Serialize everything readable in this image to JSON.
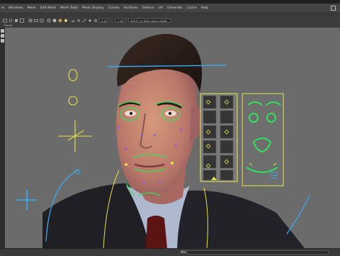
{
  "menu": {
    "items": [
      "le",
      "Windows",
      "Mesh",
      "Edit Mesh",
      "Mesh Tools",
      "Mesh Display",
      "Curves",
      "Surfaces",
      "Deform",
      "UV",
      "Generate",
      "Cache",
      "Help"
    ]
  },
  "toolbar": {
    "field_a": "0.00",
    "field_b": "1.00",
    "field_label": "sRGB gamma",
    "panel_title": "ACES 1.0 SDR-video (sRGB)"
  },
  "panel": {
    "menu_label": "Panels"
  },
  "footer": {
    "mel_label": "MEL"
  },
  "colors": {
    "viewport_bg": "#6a6a6a",
    "control_green": "#33e05a",
    "control_yellow": "#e6e64a",
    "control_blue": "#3ba8f0",
    "control_purple": "#8a5fe0"
  }
}
